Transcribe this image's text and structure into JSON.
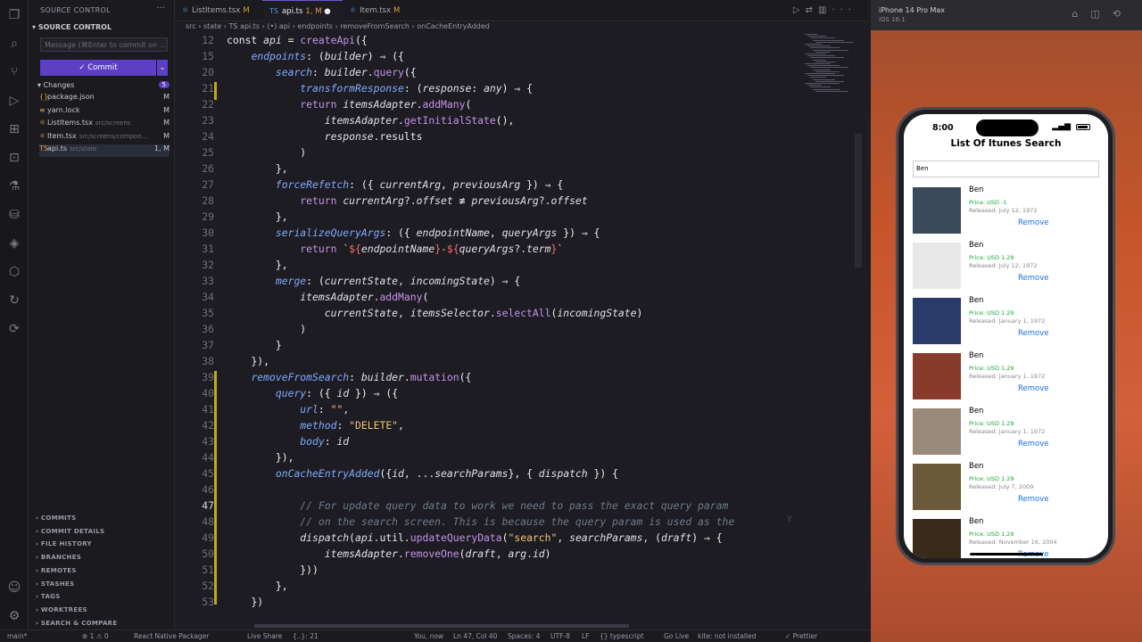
{
  "activity_icons": [
    "files-icon",
    "search-icon",
    "source-control-icon",
    "run-debug-icon",
    "extensions-icon",
    "remote-icon",
    "testing-icon",
    "database-icon",
    "git-icon",
    "docker-icon",
    "live-share-icon",
    "settings-sync-icon",
    "account-icon",
    "manage-gear-icon"
  ],
  "sidebar": {
    "title": "SOURCE CONTROL",
    "subtitle": "SOURCE CONTROL",
    "message_placeholder": "Message (⌘Enter to commit on ...",
    "commit_label": "✓ Commit",
    "changes_label": "Changes",
    "changes_count": "5",
    "files": [
      {
        "name": "package.json",
        "path": "",
        "status": "M",
        "icon": "{}"
      },
      {
        "name": "yarn.lock",
        "path": "",
        "status": "M",
        "icon": "≡"
      },
      {
        "name": "ListItems.tsx",
        "path": "src/screens",
        "status": "M",
        "icon": "⚛"
      },
      {
        "name": "Item.tsx",
        "path": "src/screens/compon...",
        "status": "M",
        "icon": "⚛"
      },
      {
        "name": "api.ts",
        "path": "src/state",
        "status": "1, M",
        "icon": "TS"
      }
    ],
    "sections": [
      "COMMITS",
      "COMMIT DETAILS",
      "FILE HISTORY",
      "BRANCHES",
      "REMOTES",
      "STASHES",
      "TAGS",
      "WORKTREES",
      "SEARCH & COMPARE"
    ]
  },
  "tabs": [
    {
      "label": "ListItems.tsx",
      "status": "M",
      "icon": "⚛"
    },
    {
      "label": "api.ts",
      "status": "1, M",
      "icon": "TS",
      "modified_dot": "●"
    },
    {
      "label": "Item.tsx",
      "status": "M",
      "icon": "⚛"
    }
  ],
  "breadcrumb": "src › state › TS api.ts › (•) api › endpoints › removeFromSearch › onCacheEntryAdded",
  "editor": {
    "line_numbers": [
      "12",
      "15",
      "20",
      "21",
      "22",
      "23",
      "24",
      "25",
      "26",
      "27",
      "28",
      "29",
      "30",
      "31",
      "32",
      "33",
      "34",
      "35",
      "36",
      "37",
      "38",
      "39",
      "40",
      "41",
      "42",
      "43",
      "44",
      "45",
      "46",
      "47",
      "48",
      "49",
      "50",
      "51",
      "52",
      "53"
    ],
    "inline_hint": "Y"
  },
  "status_bar": {
    "branch": "main*",
    "errors": "⊗ 1  ⚠ 0",
    "packager": "React Native Packager",
    "live_share": "Live Share",
    "selection": "{..}: 21",
    "blame": "You, now",
    "position": "Ln 47, Col 40",
    "spaces": "Spaces: 4",
    "encoding": "UTF-8",
    "eol": "LF",
    "language": "{} typescript",
    "golive": "Go Live",
    "kite": "kite: not installed",
    "prettier": "✓ Prettier"
  },
  "simulator": {
    "device": "iPhone 14 Pro Max",
    "os": "iOS 16.1",
    "time": "8:00",
    "app_title": "List Of Itunes Search",
    "search_value": "Ben",
    "items": [
      {
        "name": "Ben",
        "price": "Price: USD -1",
        "released": "Released: July 12, 1972",
        "remove": "Remove",
        "thumb": "#3a4a5a"
      },
      {
        "name": "Ben",
        "price": "Price: USD 1.29",
        "released": "Released: July 12, 1972",
        "remove": "Remove",
        "thumb": "#e8e8e8"
      },
      {
        "name": "Ben",
        "price": "Price: USD 1.29",
        "released": "Released: January 1, 1972",
        "remove": "Remove",
        "thumb": "#2a3a6a"
      },
      {
        "name": "Ben",
        "price": "Price: USD 1.29",
        "released": "Released: January 1, 1972",
        "remove": "Remove",
        "thumb": "#8a3a2a"
      },
      {
        "name": "Ben",
        "price": "Price: USD 1.29",
        "released": "Released: January 1, 1972",
        "remove": "Remove",
        "thumb": "#9a8a7a"
      },
      {
        "name": "Ben",
        "price": "Price: USD 1.29",
        "released": "Released: July 7, 2009",
        "remove": "Remove",
        "thumb": "#6a5a3a"
      },
      {
        "name": "Ben",
        "price": "Price: USD 1.29",
        "released": "Released: November 16, 2004",
        "remove": "Remove",
        "thumb": "#3a2a1a"
      }
    ]
  }
}
